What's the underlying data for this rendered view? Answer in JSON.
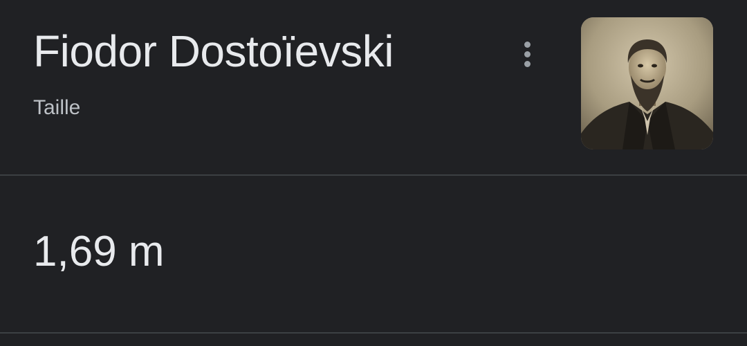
{
  "entity": {
    "name": "Fiodor Dostoïevski",
    "attribute": "Taille",
    "value": "1,69 m"
  },
  "icons": {
    "more": "more-vert-icon"
  },
  "colors": {
    "background": "#202124",
    "primary_text": "#e8eaed",
    "secondary_text": "#bdc1c6",
    "divider": "#3c4043",
    "icon": "#9aa0a6"
  }
}
